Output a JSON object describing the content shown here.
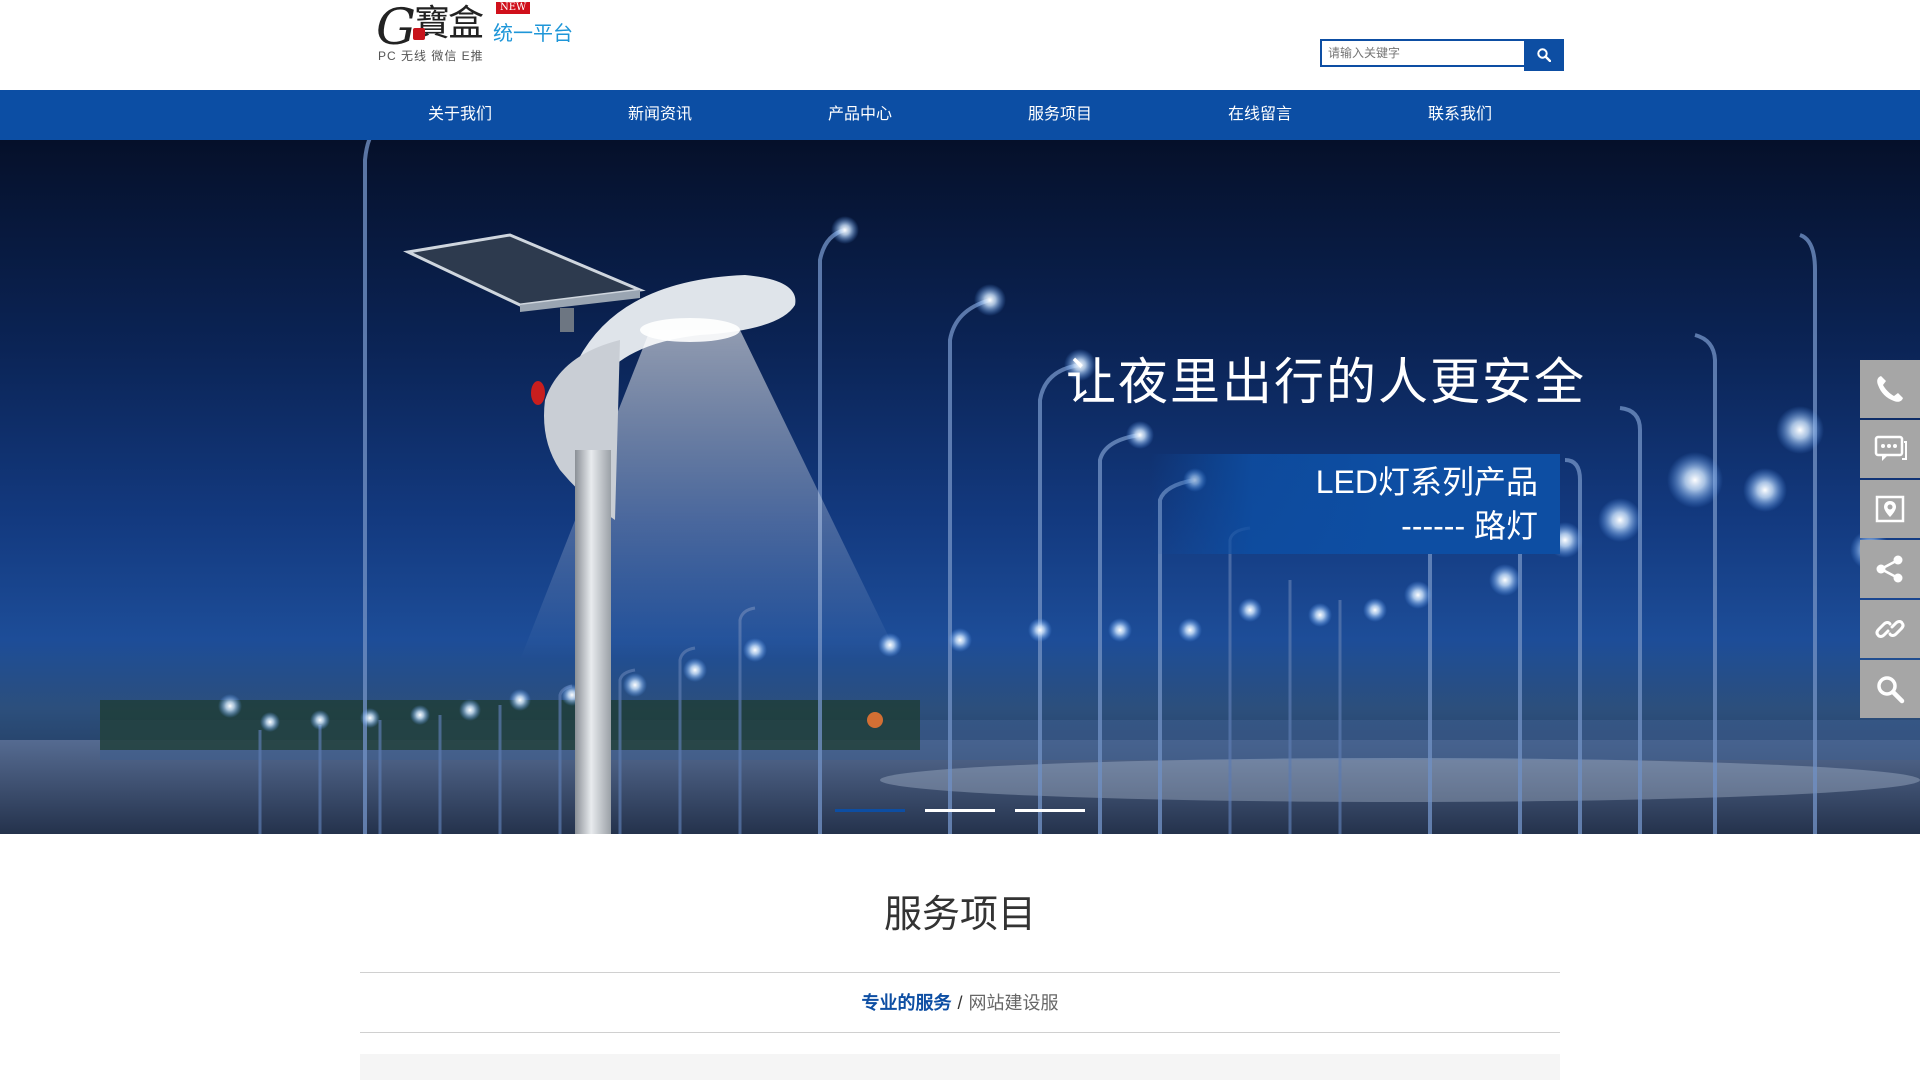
{
  "header": {
    "logo": {
      "g": "G",
      "chinese": "寶盒",
      "new_badge": "NEW",
      "platform": "统一平台",
      "subtitle": "PC 无线  微信  E推"
    },
    "search": {
      "placeholder": "请输入关键字",
      "icon": "search-icon"
    }
  },
  "nav": {
    "items": [
      {
        "label": "关于我们"
      },
      {
        "label": "新闻资讯"
      },
      {
        "label": "产品中心"
      },
      {
        "label": "服务项目"
      },
      {
        "label": "在线留言"
      },
      {
        "label": "联系我们"
      }
    ]
  },
  "banner": {
    "headline": "让夜里出行的人更安全",
    "line1": "LED灯系列产品",
    "line2": "------ 路灯",
    "slide_count": 3,
    "active_slide": 0
  },
  "side_toolbar": {
    "icons": [
      "phone-icon",
      "message-icon",
      "map-icon",
      "share-icon",
      "link-icon",
      "search-icon"
    ]
  },
  "section": {
    "title": "服务项目",
    "sub_strong": "专业的服务",
    "sub_sep": "/",
    "sub_light": "网站建设服"
  },
  "colors": {
    "brand_blue": "#0c4ea4",
    "platform_blue": "#1e96d8",
    "side_gray": "#a6a6a6",
    "badge_red": "#d0101b"
  }
}
